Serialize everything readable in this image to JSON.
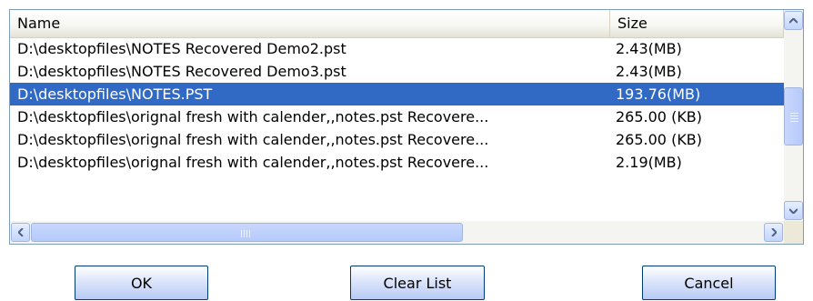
{
  "list": {
    "columns": {
      "name": "Name",
      "size": "Size"
    },
    "rows": [
      {
        "name": "D:\\desktopfiles\\NOTES Recovered Demo2.pst",
        "size": "2.43(MB)",
        "selected": false
      },
      {
        "name": "D:\\desktopfiles\\NOTES Recovered Demo3.pst",
        "size": "2.43(MB)",
        "selected": false
      },
      {
        "name": "D:\\desktopfiles\\NOTES.PST",
        "size": "193.76(MB)",
        "selected": true
      },
      {
        "name": "D:\\desktopfiles\\orignal fresh with calender,,notes.pst Recovere...",
        "size": "265.00 (KB)",
        "selected": false
      },
      {
        "name": "D:\\desktopfiles\\orignal fresh with calender,,notes.pst Recovere...",
        "size": "265.00 (KB)",
        "selected": false
      },
      {
        "name": "D:\\desktopfiles\\orignal fresh with calender,,notes.pst Recovere...",
        "size": "2.19(MB)",
        "selected": false
      }
    ]
  },
  "scrollbars": {
    "up_icon": "arrow-up-icon",
    "down_icon": "arrow-down-icon",
    "left_icon": "arrow-left-icon",
    "right_icon": "arrow-right-icon"
  },
  "buttons": {
    "ok": "OK",
    "clear": "Clear List",
    "cancel": "Cancel"
  },
  "colors": {
    "selection": "#316ac5",
    "button_border": "#003c74",
    "list_border": "#7f9db9"
  }
}
